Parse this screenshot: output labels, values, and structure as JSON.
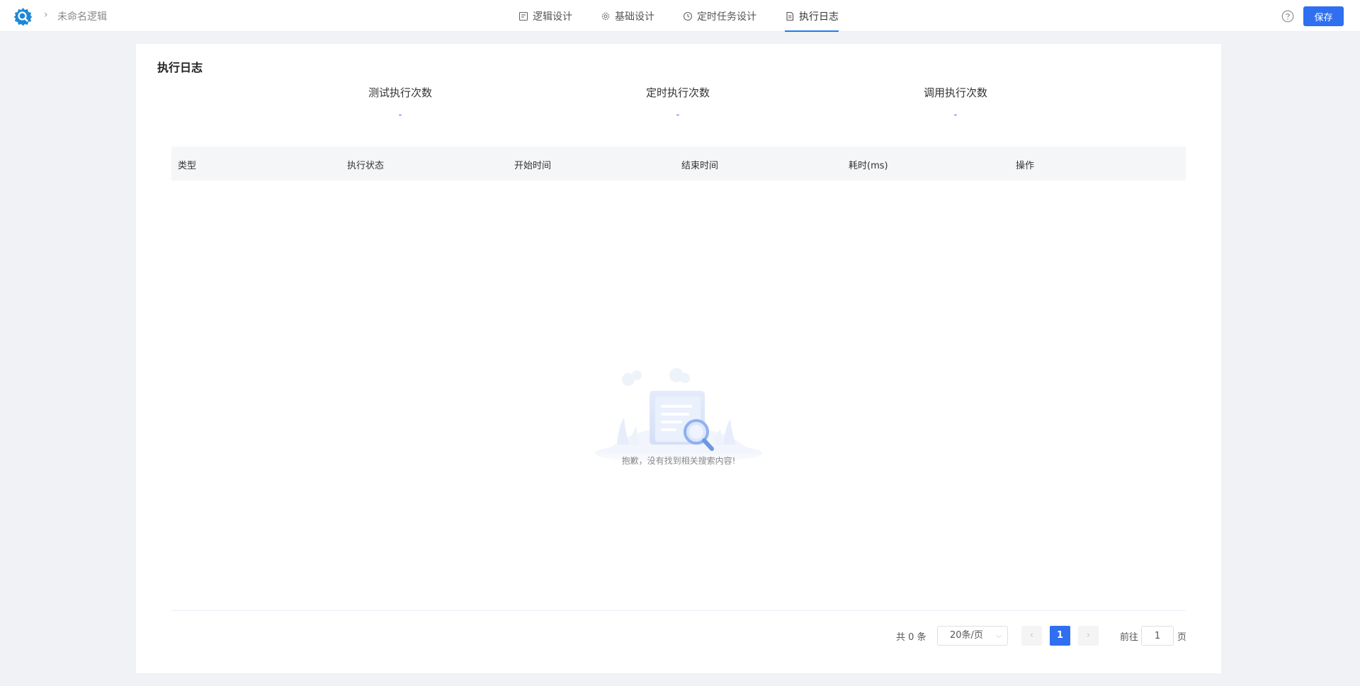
{
  "header": {
    "breadcrumb_separator": "›",
    "logic_name": "未命名逻辑",
    "tabs": [
      {
        "label": "逻辑设计",
        "icon": "logic-design-icon"
      },
      {
        "label": "基础设计",
        "icon": "gear-icon"
      },
      {
        "label": "定时任务设计",
        "icon": "clock-icon"
      },
      {
        "label": "执行日志",
        "icon": "document-icon",
        "active": true
      }
    ],
    "save_label": "保存",
    "help_icon": "question-circle-icon"
  },
  "log_panel": {
    "title": "执行日志",
    "stats": [
      {
        "label": "测试执行次数",
        "value": "-"
      },
      {
        "label": "定时执行次数",
        "value": "-"
      },
      {
        "label": "调用执行次数",
        "value": "-"
      }
    ],
    "table": {
      "columns": [
        "类型",
        "执行状态",
        "开始时间",
        "结束时间",
        "耗时(ms)",
        "操作"
      ],
      "rows": []
    },
    "empty_text": "抱歉，没有找到相关搜索内容!"
  },
  "pagination": {
    "total_text": "共 0 条",
    "page_size": "20条/页",
    "current_page": "1",
    "goto_label": "前往",
    "goto_value": "1",
    "page_suffix": "页"
  },
  "colors": {
    "accent": "#2f6ff0",
    "background": "#f0f2f5"
  }
}
